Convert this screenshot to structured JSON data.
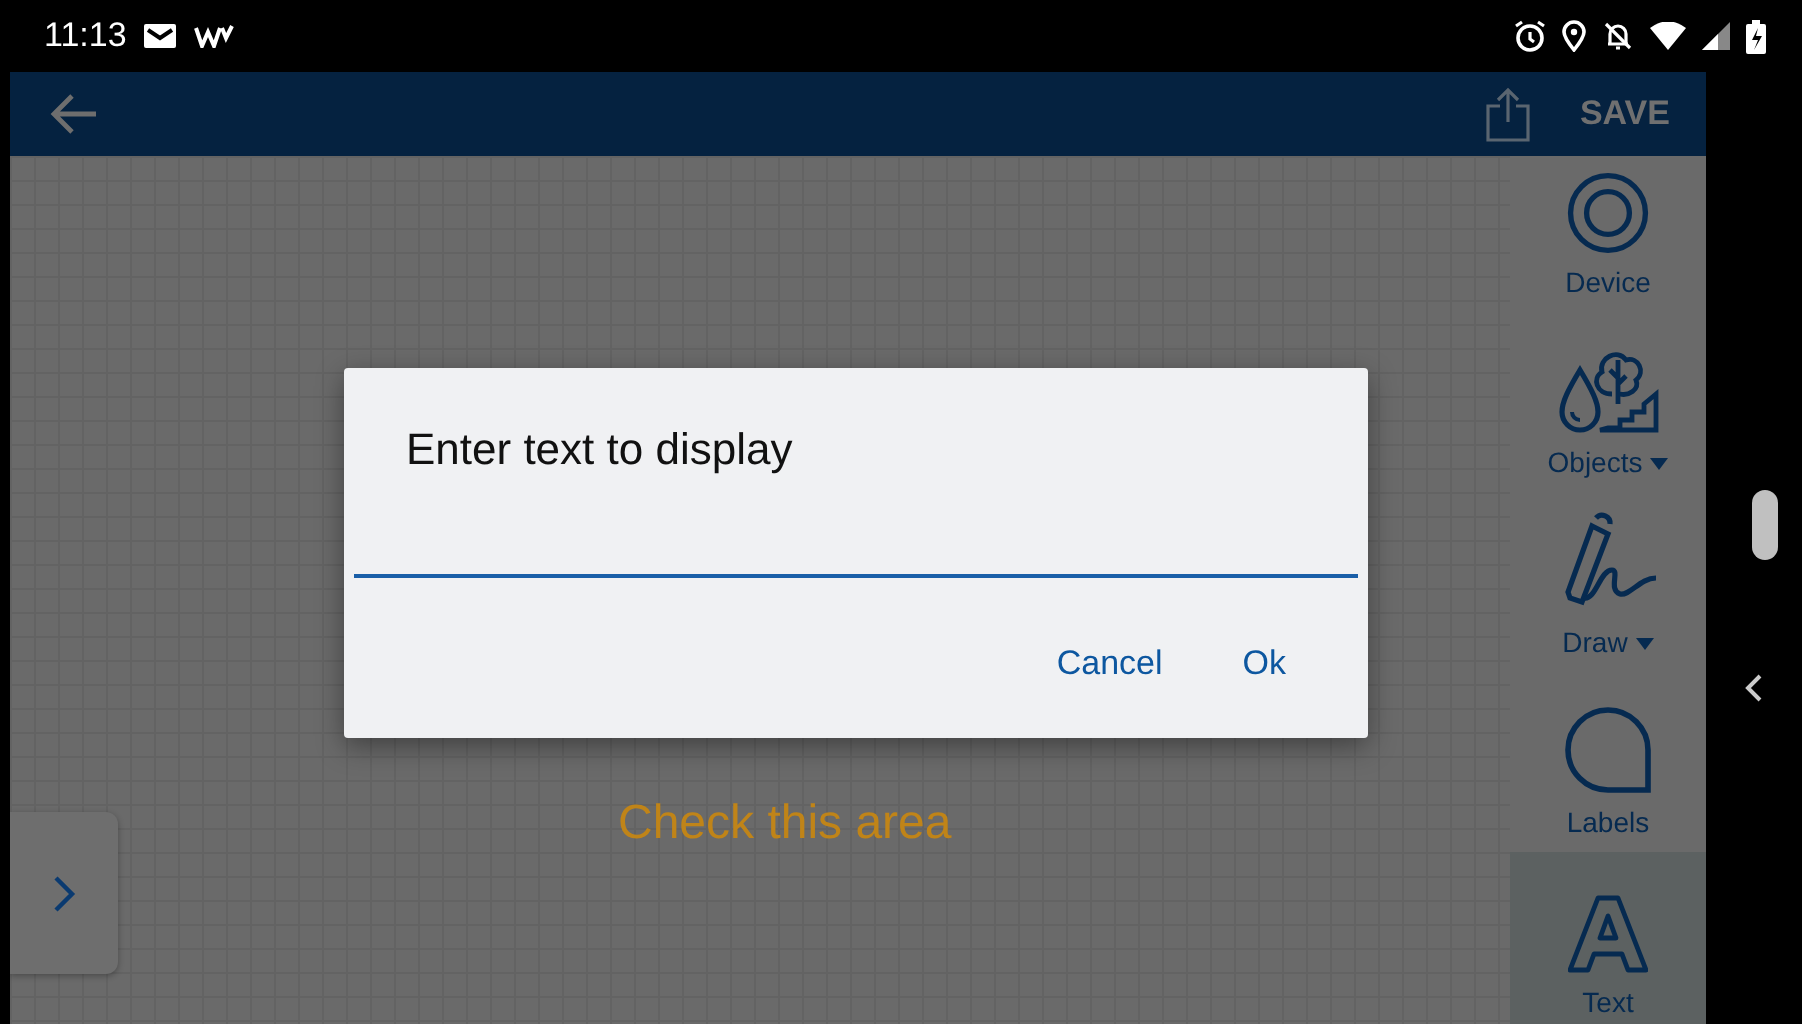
{
  "status_bar": {
    "time": "11:13"
  },
  "app_bar": {
    "action": "SAVE"
  },
  "toolbar": [
    {
      "kind": "device",
      "label": "Device",
      "dropdown": false,
      "selected": false
    },
    {
      "kind": "objects",
      "label": "Objects",
      "dropdown": true,
      "selected": false
    },
    {
      "kind": "draw",
      "label": "Draw",
      "dropdown": true,
      "selected": false
    },
    {
      "kind": "labels",
      "label": "Labels",
      "dropdown": false,
      "selected": false
    },
    {
      "kind": "text",
      "label": "Text",
      "dropdown": false,
      "selected": true
    }
  ],
  "canvas": {
    "label": "Check this area"
  },
  "dialog": {
    "title": "Enter text to display",
    "buttons": [
      "Cancel",
      "Ok"
    ]
  }
}
